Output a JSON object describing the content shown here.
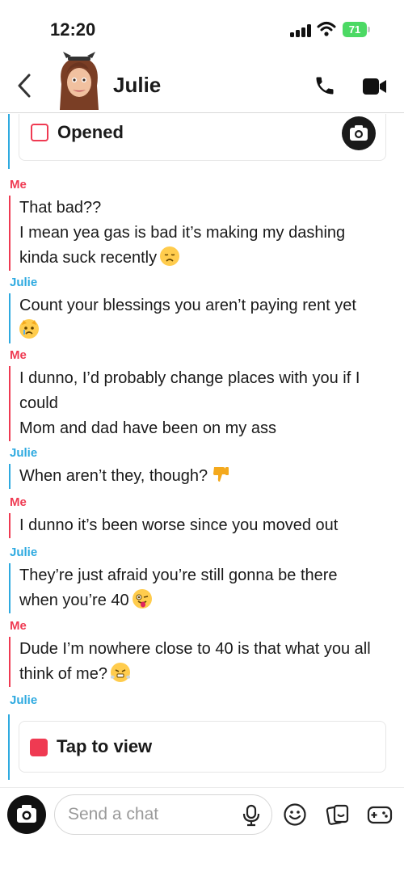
{
  "status_bar": {
    "time": "12:20",
    "battery": "71"
  },
  "header": {
    "contact_name": "Julie"
  },
  "chat": {
    "opened_label": "Opened",
    "messages": [
      {
        "sender": "Me",
        "lines": [
          "That bad??",
          "I mean yea gas is bad it’s making my dashing",
          "kinda suck recently"
        ],
        "emoji": "disappointed-face"
      },
      {
        "sender": "Julie",
        "lines": [
          "Count your blessings you aren’t paying rent yet"
        ],
        "emoji": "crying-cat-face"
      },
      {
        "sender": "Me",
        "lines": [
          "I dunno, I’d probably change places with you if I",
          "could",
          "Mom and dad have been on my ass"
        ]
      },
      {
        "sender": "Julie",
        "lines": [
          "When aren’t they, though?"
        ],
        "emoji": "thumbs-down"
      },
      {
        "sender": "Me",
        "lines": [
          "I dunno it’s been worse since you moved out"
        ]
      },
      {
        "sender": "Julie",
        "lines": [
          "They’re just afraid you’re still gonna be there",
          "when you’re 40"
        ],
        "emoji": "winking-face-with-tongue"
      },
      {
        "sender": "Me",
        "lines": [
          "Dude I’m nowhere close to 40 is that what you all",
          "think of me?"
        ],
        "emoji": "face-with-steam-from-nose"
      },
      {
        "sender": "Julie",
        "lines": []
      }
    ],
    "tap_label": "Tap to view"
  },
  "composer": {
    "placeholder": "Send a chat"
  },
  "colors": {
    "me": "#ef3a52",
    "julie": "#2eaae0",
    "battery": "#4cd964"
  }
}
